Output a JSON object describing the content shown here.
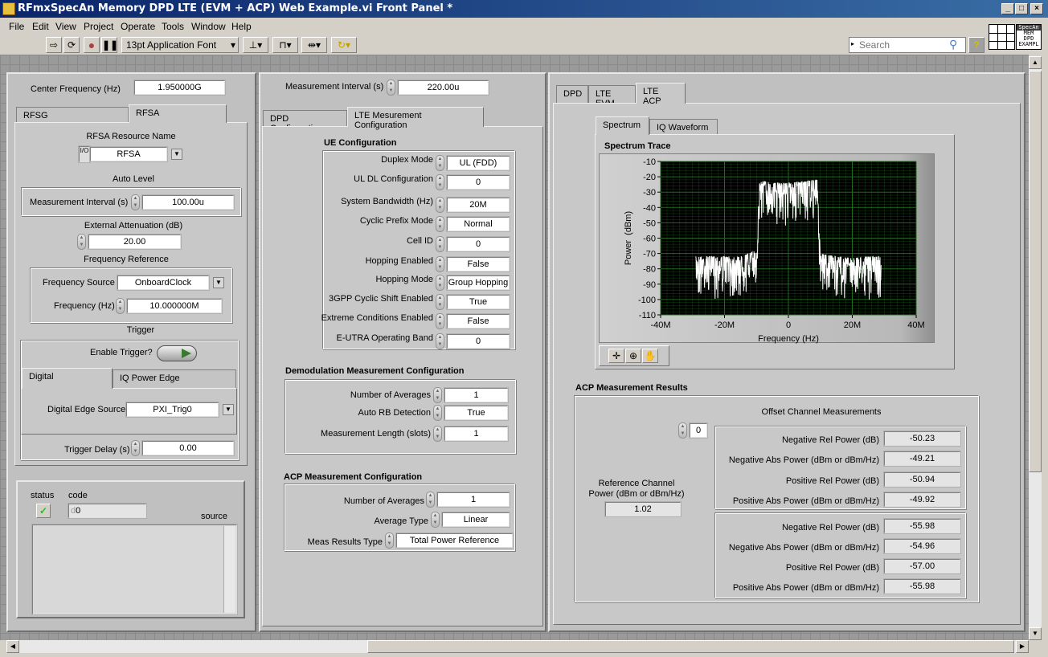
{
  "window": {
    "title": "RFmxSpecAn Memory DPD LTE (EVM + ACP) Web Example.vi Front Panel *",
    "controls": [
      "_",
      "□",
      "×"
    ]
  },
  "menu": [
    "File",
    "Edit",
    "View",
    "Project",
    "Operate",
    "Tools",
    "Window",
    "Help"
  ],
  "toolbar": {
    "font": "13pt Application Font",
    "search_placeholder": "Search",
    "help": "?",
    "vi_icon_lines": [
      "SpecAn",
      "MEM",
      "DPD",
      "EXAMPL"
    ]
  },
  "left": {
    "center_frequency": {
      "label": "Center Frequency (Hz)",
      "value": "1.950000G"
    },
    "tabs": [
      "RFSG",
      "RFSA"
    ],
    "rfsa_resource": {
      "label": "RFSA Resource Name",
      "value": "RFSA"
    },
    "auto_level": {
      "label": "Auto Level",
      "interval_label": "Measurement Interval (s)",
      "interval_value": "100.00u"
    },
    "attenuation": {
      "label": "External Attenuation (dB)",
      "value": "20.00"
    },
    "freq_ref": {
      "label": "Frequency Reference",
      "source_label": "Frequency Source",
      "source_value": "OnboardClock",
      "freq_label": "Frequency (Hz)",
      "freq_value": "10.000000M"
    },
    "trigger": {
      "label": "Trigger",
      "enable_label": "Enable Trigger?",
      "enabled": false,
      "tabs": [
        "Digital",
        "IQ Power Edge"
      ],
      "edge_label": "Digital Edge Source",
      "edge_value": "PXI_Trig0",
      "delay_label": "Trigger Delay (s)",
      "delay_value": "0.00"
    },
    "error": {
      "status_label": "status",
      "code_label": "code",
      "code_value": "0",
      "code_prefix": "d",
      "source_label": "source",
      "status_ok": true
    }
  },
  "middle": {
    "interval": {
      "label": "Measurement Interval (s)",
      "value": "220.00u"
    },
    "tabs": [
      "DPD Configuration",
      "LTE Mesurement Configuration"
    ],
    "ue": {
      "title": "UE Configuration",
      "rows": [
        {
          "label": "Duplex Mode",
          "value": "UL (FDD)"
        },
        {
          "label": "UL DL Configuration",
          "value": "0"
        },
        {
          "label": "System Bandwidth (Hz)",
          "value": "20M"
        },
        {
          "label": "Cyclic Prefix Mode",
          "value": "Normal"
        },
        {
          "label": "Cell ID",
          "value": "0"
        },
        {
          "label": "Hopping Enabled",
          "value": "False"
        },
        {
          "label": "Hopping Mode",
          "value": "Group Hopping"
        },
        {
          "label": "3GPP Cyclic Shift Enabled",
          "value": "True"
        },
        {
          "label": "Extreme Conditions Enabled",
          "value": "False"
        },
        {
          "label": "E-UTRA Operating Band",
          "value": "0"
        }
      ]
    },
    "demod": {
      "title": "Demodulation Measurement Configuration",
      "rows": [
        {
          "label": "Number of Averages",
          "value": "1"
        },
        {
          "label": "Auto RB Detection",
          "value": "True"
        },
        {
          "label": "Measurement Length (slots)",
          "value": "1"
        }
      ]
    },
    "acp": {
      "title": "ACP Measurement Configuration",
      "rows": [
        {
          "label": "Number of Averages",
          "value": "1"
        },
        {
          "label": "Average Type",
          "value": "Linear"
        },
        {
          "label": "Meas Results Type",
          "value": "Total Power Reference"
        }
      ]
    }
  },
  "right": {
    "tabs": [
      "DPD",
      "LTE EVM",
      "LTE ACP"
    ],
    "subtabs": [
      "Spectrum",
      "IQ Waveform"
    ],
    "graph_title": "Spectrum Trace",
    "acp_title": "ACP Measurement Results",
    "offset_title": "Offset Channel Measurements",
    "offset_index": "0",
    "ref_label_1": "Reference Channel",
    "ref_label_2": "Power (dBm or dBm/Hz)",
    "ref_value": "1.02",
    "offsets": [
      [
        {
          "label": "Negative Rel Power (dB)",
          "value": "-50.23"
        },
        {
          "label": "Negative Abs Power (dBm or dBm/Hz)",
          "value": "-49.21"
        },
        {
          "label": "Positive Rel Power (dB)",
          "value": "-50.94"
        },
        {
          "label": "Positive Abs Power (dBm or dBm/Hz)",
          "value": "-49.92"
        }
      ],
      [
        {
          "label": "Negative Rel Power (dB)",
          "value": "-55.98"
        },
        {
          "label": "Negative Abs Power (dBm or dBm/Hz)",
          "value": "-54.96"
        },
        {
          "label": "Positive Rel Power (dB)",
          "value": "-57.00"
        },
        {
          "label": "Positive Abs Power (dBm or dBm/Hz)",
          "value": "-55.98"
        }
      ]
    ]
  },
  "chart_data": {
    "type": "line",
    "xlabel": "Frequency (Hz)",
    "ylabel": "Power  (dBm)",
    "xlim": [
      -40000000,
      40000000
    ],
    "ylim": [
      -110,
      -10
    ],
    "xticks": [
      "-40M",
      "-20M",
      "0",
      "20M",
      "40M"
    ],
    "yticks": [
      "-10",
      "-20",
      "-30",
      "-40",
      "-50",
      "-60",
      "-70",
      "-80",
      "-90",
      "-100",
      "-110"
    ],
    "grid": true,
    "trace_color": "#ffffff",
    "background": "#000000",
    "grid_color": "#1f6a1f",
    "x": [
      -29000000,
      -25000000,
      -20000000,
      -15000000,
      -10000000,
      -9000000,
      -5000000,
      0,
      5000000,
      9000000,
      10000000,
      15000000,
      20000000,
      25000000,
      29000000
    ],
    "y": [
      -80,
      -80,
      -80,
      -80,
      -76,
      -30,
      -32,
      -32,
      -31,
      -30,
      -78,
      -80,
      -81,
      -80,
      -80
    ]
  }
}
